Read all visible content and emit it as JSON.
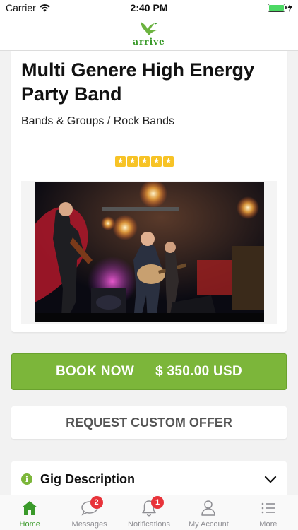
{
  "status_bar": {
    "carrier": "Carrier",
    "time": "2:40 PM"
  },
  "header": {
    "logo_text": "arrive"
  },
  "gig": {
    "title": "Multi Genere High Energy Party Band",
    "category": "Bands & Groups / Rock Bands",
    "rating": 5,
    "stars": [
      "★",
      "★",
      "★",
      "★",
      "★"
    ]
  },
  "actions": {
    "book_label": "BOOK NOW",
    "price": "$ 350.00 USD",
    "custom_offer_label": "REQUEST CUSTOM OFFER"
  },
  "description": {
    "title": "Gig Description",
    "icon": "i"
  },
  "tabs": [
    {
      "label": "Home",
      "icon": "home-icon",
      "active": true
    },
    {
      "label": "Messages",
      "icon": "chat-bubble-icon",
      "badge": "2"
    },
    {
      "label": "Notifications",
      "icon": "bell-icon",
      "badge": "1"
    },
    {
      "label": "My Account",
      "icon": "user-icon"
    },
    {
      "label": "More",
      "icon": "list-icon"
    }
  ],
  "colors": {
    "accent": "#7cb63a",
    "badge": "#e8333a",
    "star": "#f7c326"
  }
}
